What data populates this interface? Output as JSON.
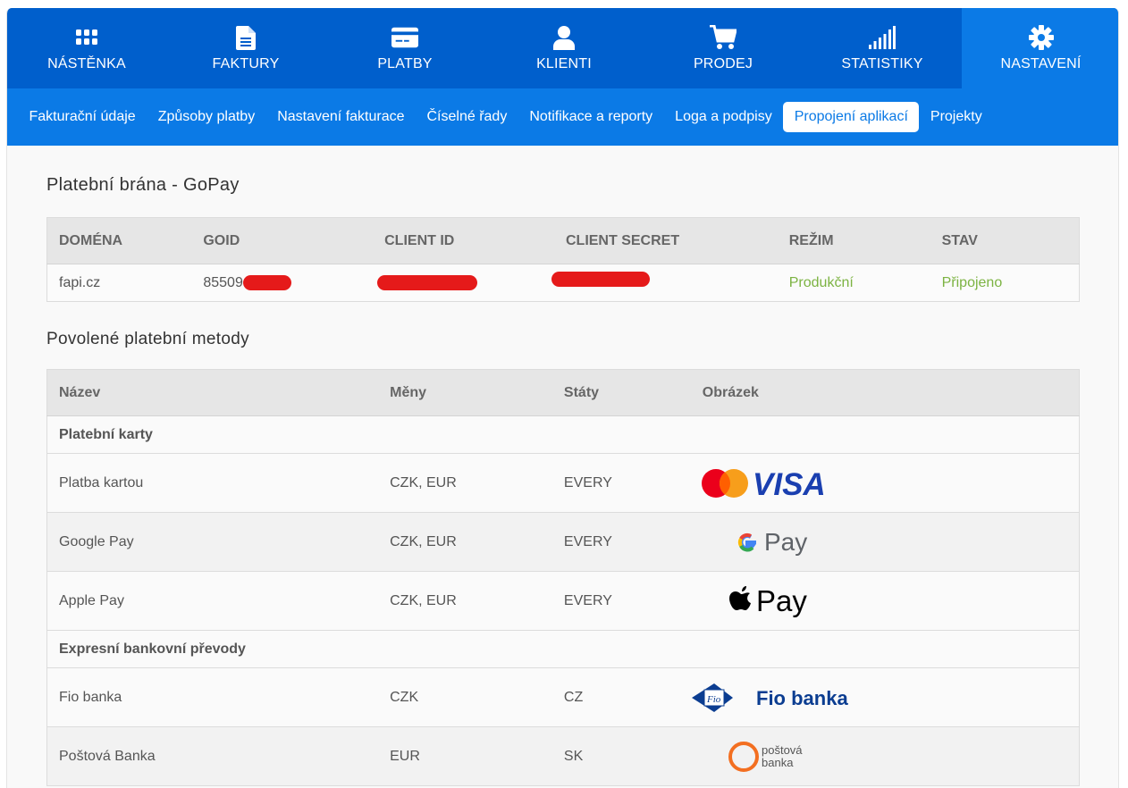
{
  "nav": {
    "items": [
      {
        "label": "NÁSTĚNKA",
        "icon": "grid-icon"
      },
      {
        "label": "FAKTURY",
        "icon": "document-icon"
      },
      {
        "label": "PLATBY",
        "icon": "credit-card-icon"
      },
      {
        "label": "KLIENTI",
        "icon": "user-icon"
      },
      {
        "label": "PRODEJ",
        "icon": "cart-icon"
      },
      {
        "label": "STATISTIKY",
        "icon": "signal-bars-icon"
      },
      {
        "label": "NASTAVENÍ",
        "icon": "gear-icon",
        "active": true
      }
    ]
  },
  "subnav": {
    "items": [
      "Fakturační údaje",
      "Způsoby platby",
      "Nastavení fakturace",
      "Číselné řady",
      "Notifikace a reporty",
      "Loga a podpisy",
      "Propojení aplikací",
      "Projekty"
    ],
    "active_index": 6
  },
  "gateway": {
    "title": "Platební brána - GoPay",
    "headers": [
      "DOMÉNA",
      "GOID",
      "CLIENT ID",
      "CLIENT SECRET",
      "REŽIM",
      "STAV"
    ],
    "row": {
      "domain": "fapi.cz",
      "goid": "85509",
      "client_id": "",
      "client_secret": "",
      "mode": "Produkční",
      "status": "Připojeno"
    },
    "status_color": "#7cb342"
  },
  "methods": {
    "title": "Povolené platební metody",
    "headers": [
      "Název",
      "Měny",
      "Státy",
      "Obrázek"
    ],
    "groups": [
      {
        "name": "Platební karty",
        "rows": [
          {
            "name": "Platba kartou",
            "currencies": "CZK, EUR",
            "states": "EVERY",
            "logo": "mastercard-visa-logo"
          },
          {
            "name": "Google Pay",
            "currencies": "CZK, EUR",
            "states": "EVERY",
            "logo": "google-pay-logo"
          },
          {
            "name": "Apple Pay",
            "currencies": "CZK, EUR",
            "states": "EVERY",
            "logo": "apple-pay-logo"
          }
        ]
      },
      {
        "name": "Expresní bankovní převody",
        "rows": [
          {
            "name": "Fio banka",
            "currencies": "CZK",
            "states": "CZ",
            "logo": "fio-banka-logo",
            "logo_text": "Fio banka"
          },
          {
            "name": "Poštová Banka",
            "currencies": "EUR",
            "states": "SK",
            "logo": "postova-banka-logo",
            "logo_text": "poštová banka"
          }
        ]
      }
    ]
  },
  "colors": {
    "nav_bg": "#005fcc",
    "subnav_bg": "#0b7ae6",
    "redaction": "#e51a1a"
  }
}
